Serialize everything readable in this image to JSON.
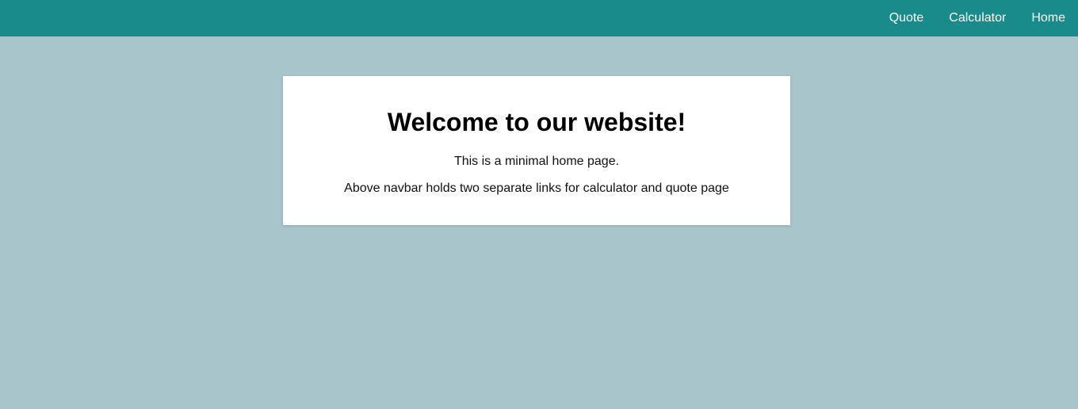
{
  "navbar": {
    "links": [
      {
        "label": "Quote"
      },
      {
        "label": "Calculator"
      },
      {
        "label": "Home"
      }
    ]
  },
  "main": {
    "title": "Welcome to our website!",
    "paragraphs": [
      "This is a minimal home page.",
      "Above navbar holds two separate links for calculator and quote page"
    ]
  },
  "colors": {
    "navbar_bg": "#188b8a",
    "page_bg": "#a8c5cb",
    "card_bg": "#ffffff"
  }
}
